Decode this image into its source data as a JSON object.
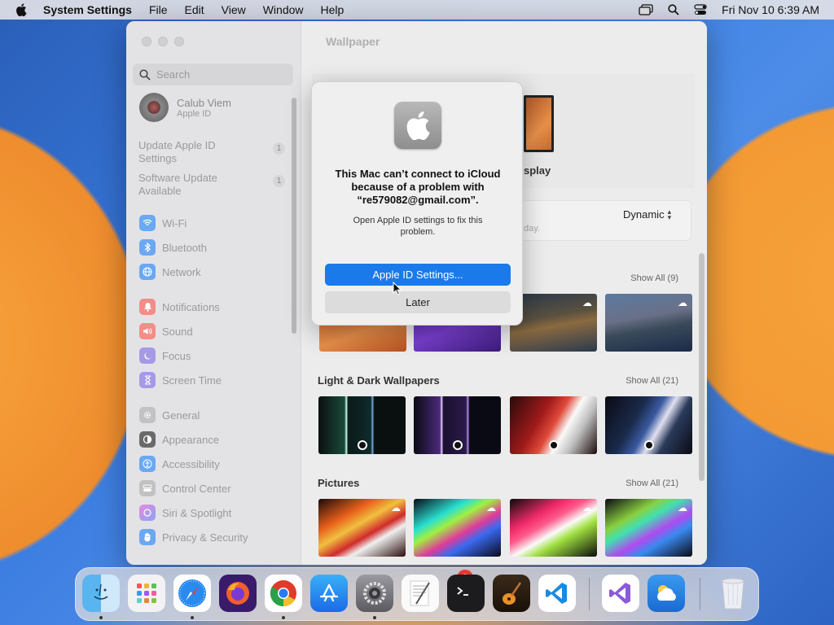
{
  "menubar": {
    "app_name": "System Settings",
    "menus": [
      "File",
      "Edit",
      "View",
      "Window",
      "Help"
    ],
    "clock": "Fri Nov 10  6:39 AM",
    "icons": [
      "screen-mirroring-icon",
      "spotlight-search-icon",
      "control-center-icon"
    ]
  },
  "sidebar": {
    "search_placeholder": "Search",
    "profile": {
      "name": "Calub Viem",
      "subtitle": "Apple ID"
    },
    "notices": [
      {
        "label": "Update Apple ID Settings",
        "count": "1"
      },
      {
        "label": "Software Update Available",
        "count": "1"
      }
    ],
    "items": [
      {
        "label": "Wi-Fi",
        "icon": "wifi-icon",
        "color": "#3a8ef6"
      },
      {
        "label": "Bluetooth",
        "icon": "bluetooth-icon",
        "color": "#3a8ef6"
      },
      {
        "label": "Network",
        "icon": "network-icon",
        "color": "#3a8ef6"
      },
      {
        "label": "Notifications",
        "icon": "bell-icon",
        "color": "#f0564f"
      },
      {
        "label": "Sound",
        "icon": "speaker-icon",
        "color": "#f0564f"
      },
      {
        "label": "Focus",
        "icon": "moon-icon",
        "color": "#6d5bd8"
      },
      {
        "label": "Screen Time",
        "icon": "hourglass-icon",
        "color": "#6d5bd8"
      },
      {
        "label": "General",
        "icon": "gear-icon",
        "color": "#9a9a9a"
      },
      {
        "label": "Appearance",
        "icon": "appearance-icon",
        "color": "#333333"
      },
      {
        "label": "Accessibility",
        "icon": "accessibility-icon",
        "color": "#3a8ef6"
      },
      {
        "label": "Control Center",
        "icon": "control-center-icon",
        "color": "#9a9a9a"
      },
      {
        "label": "Siri & Spotlight",
        "icon": "siri-icon",
        "color": "#c05adb"
      },
      {
        "label": "Privacy & Security",
        "icon": "hand-icon",
        "color": "#3a8ef6"
      }
    ]
  },
  "main": {
    "title": "Wallpaper",
    "preview_label": "splay",
    "dynamic_value": "Dynamic",
    "dynamic_sub": "day.",
    "sections": [
      {
        "title": "",
        "show_all": "Show All (9)"
      },
      {
        "title": "Light & Dark Wallpapers",
        "show_all": "Show All (21)"
      },
      {
        "title": "Pictures",
        "show_all": "Show All (21)"
      }
    ]
  },
  "dialog": {
    "message": "This Mac can’t connect to iCloud because of a problem with “re579082@gmail.com”.",
    "info": "Open Apple ID settings to fix this problem.",
    "primary_button": "Apple ID Settings...",
    "secondary_button": "Later"
  },
  "dock": {
    "apps": [
      "Finder",
      "Launchpad",
      "Safari",
      "Firefox",
      "Chrome",
      "App Store",
      "System Settings",
      "TextEdit",
      "Terminal",
      "GarageBand",
      "Visual Studio Code",
      "Visual Studio",
      "Weather",
      "Trash"
    ],
    "settings_badge": "2"
  }
}
